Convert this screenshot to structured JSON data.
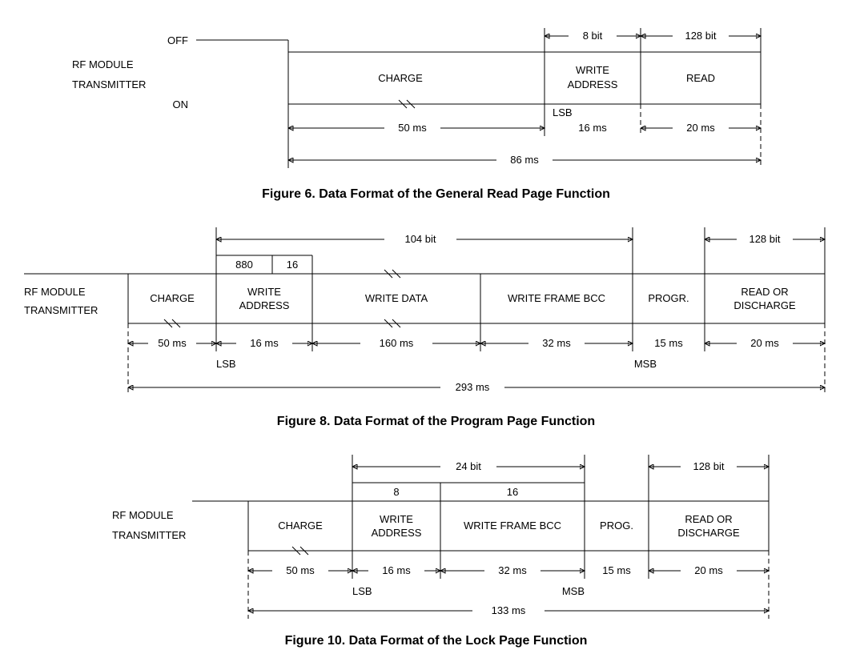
{
  "common": {
    "rf_module": "RF  MODULE",
    "transmitter": "TRANSMITTER",
    "off": "OFF",
    "on": "ON",
    "lsb": "LSB",
    "msb": "MSB"
  },
  "fig6": {
    "caption": "Figure 6. Data Format of the General Read Page Function",
    "charge": "CHARGE",
    "write_addr": "WRITE",
    "write_addr2": "ADDRESS",
    "read": "READ",
    "bits_addr": "8 bit",
    "bits_read": "128 bit",
    "t_charge": "50 ms",
    "t_addr": "16 ms",
    "t_read": "20 ms",
    "t_total": "86 ms"
  },
  "fig8": {
    "caption": "Figure 8. Data Format of the Program Page Function",
    "charge": "CHARGE",
    "wa": "WRITE",
    "wa2": "ADDRESS",
    "wd": "WRITE  DATA",
    "wbcc": "WRITE  FRAME  BCC",
    "progr": "PROGR.",
    "read": "READ  OR",
    "read2": "DISCHARGE",
    "n880": "880",
    "n16": "16",
    "bits_total": "104 bit",
    "bits_read": "128 bit",
    "t_charge": "50 ms",
    "t_addr": "16 ms",
    "t_data": "160 ms",
    "t_bcc": "32 ms",
    "t_prog": "15 ms",
    "t_read": "20 ms",
    "t_total": "293 ms"
  },
  "fig10": {
    "caption": "Figure 10. Data Format of the Lock Page Function",
    "charge": "CHARGE",
    "wa": "WRITE",
    "wa2": "ADDRESS",
    "wbcc": "WRITE  FRAME  BCC",
    "prog": "PROG.",
    "read": "READ  OR",
    "read2": "DISCHARGE",
    "n8": "8",
    "n16": "16",
    "bits_total": "24 bit",
    "bits_read": "128 bit",
    "t_charge": "50 ms",
    "t_addr": "16 ms",
    "t_bcc": "32 ms",
    "t_prog": "15 ms",
    "t_read": "20 ms",
    "t_total": "133 ms"
  }
}
